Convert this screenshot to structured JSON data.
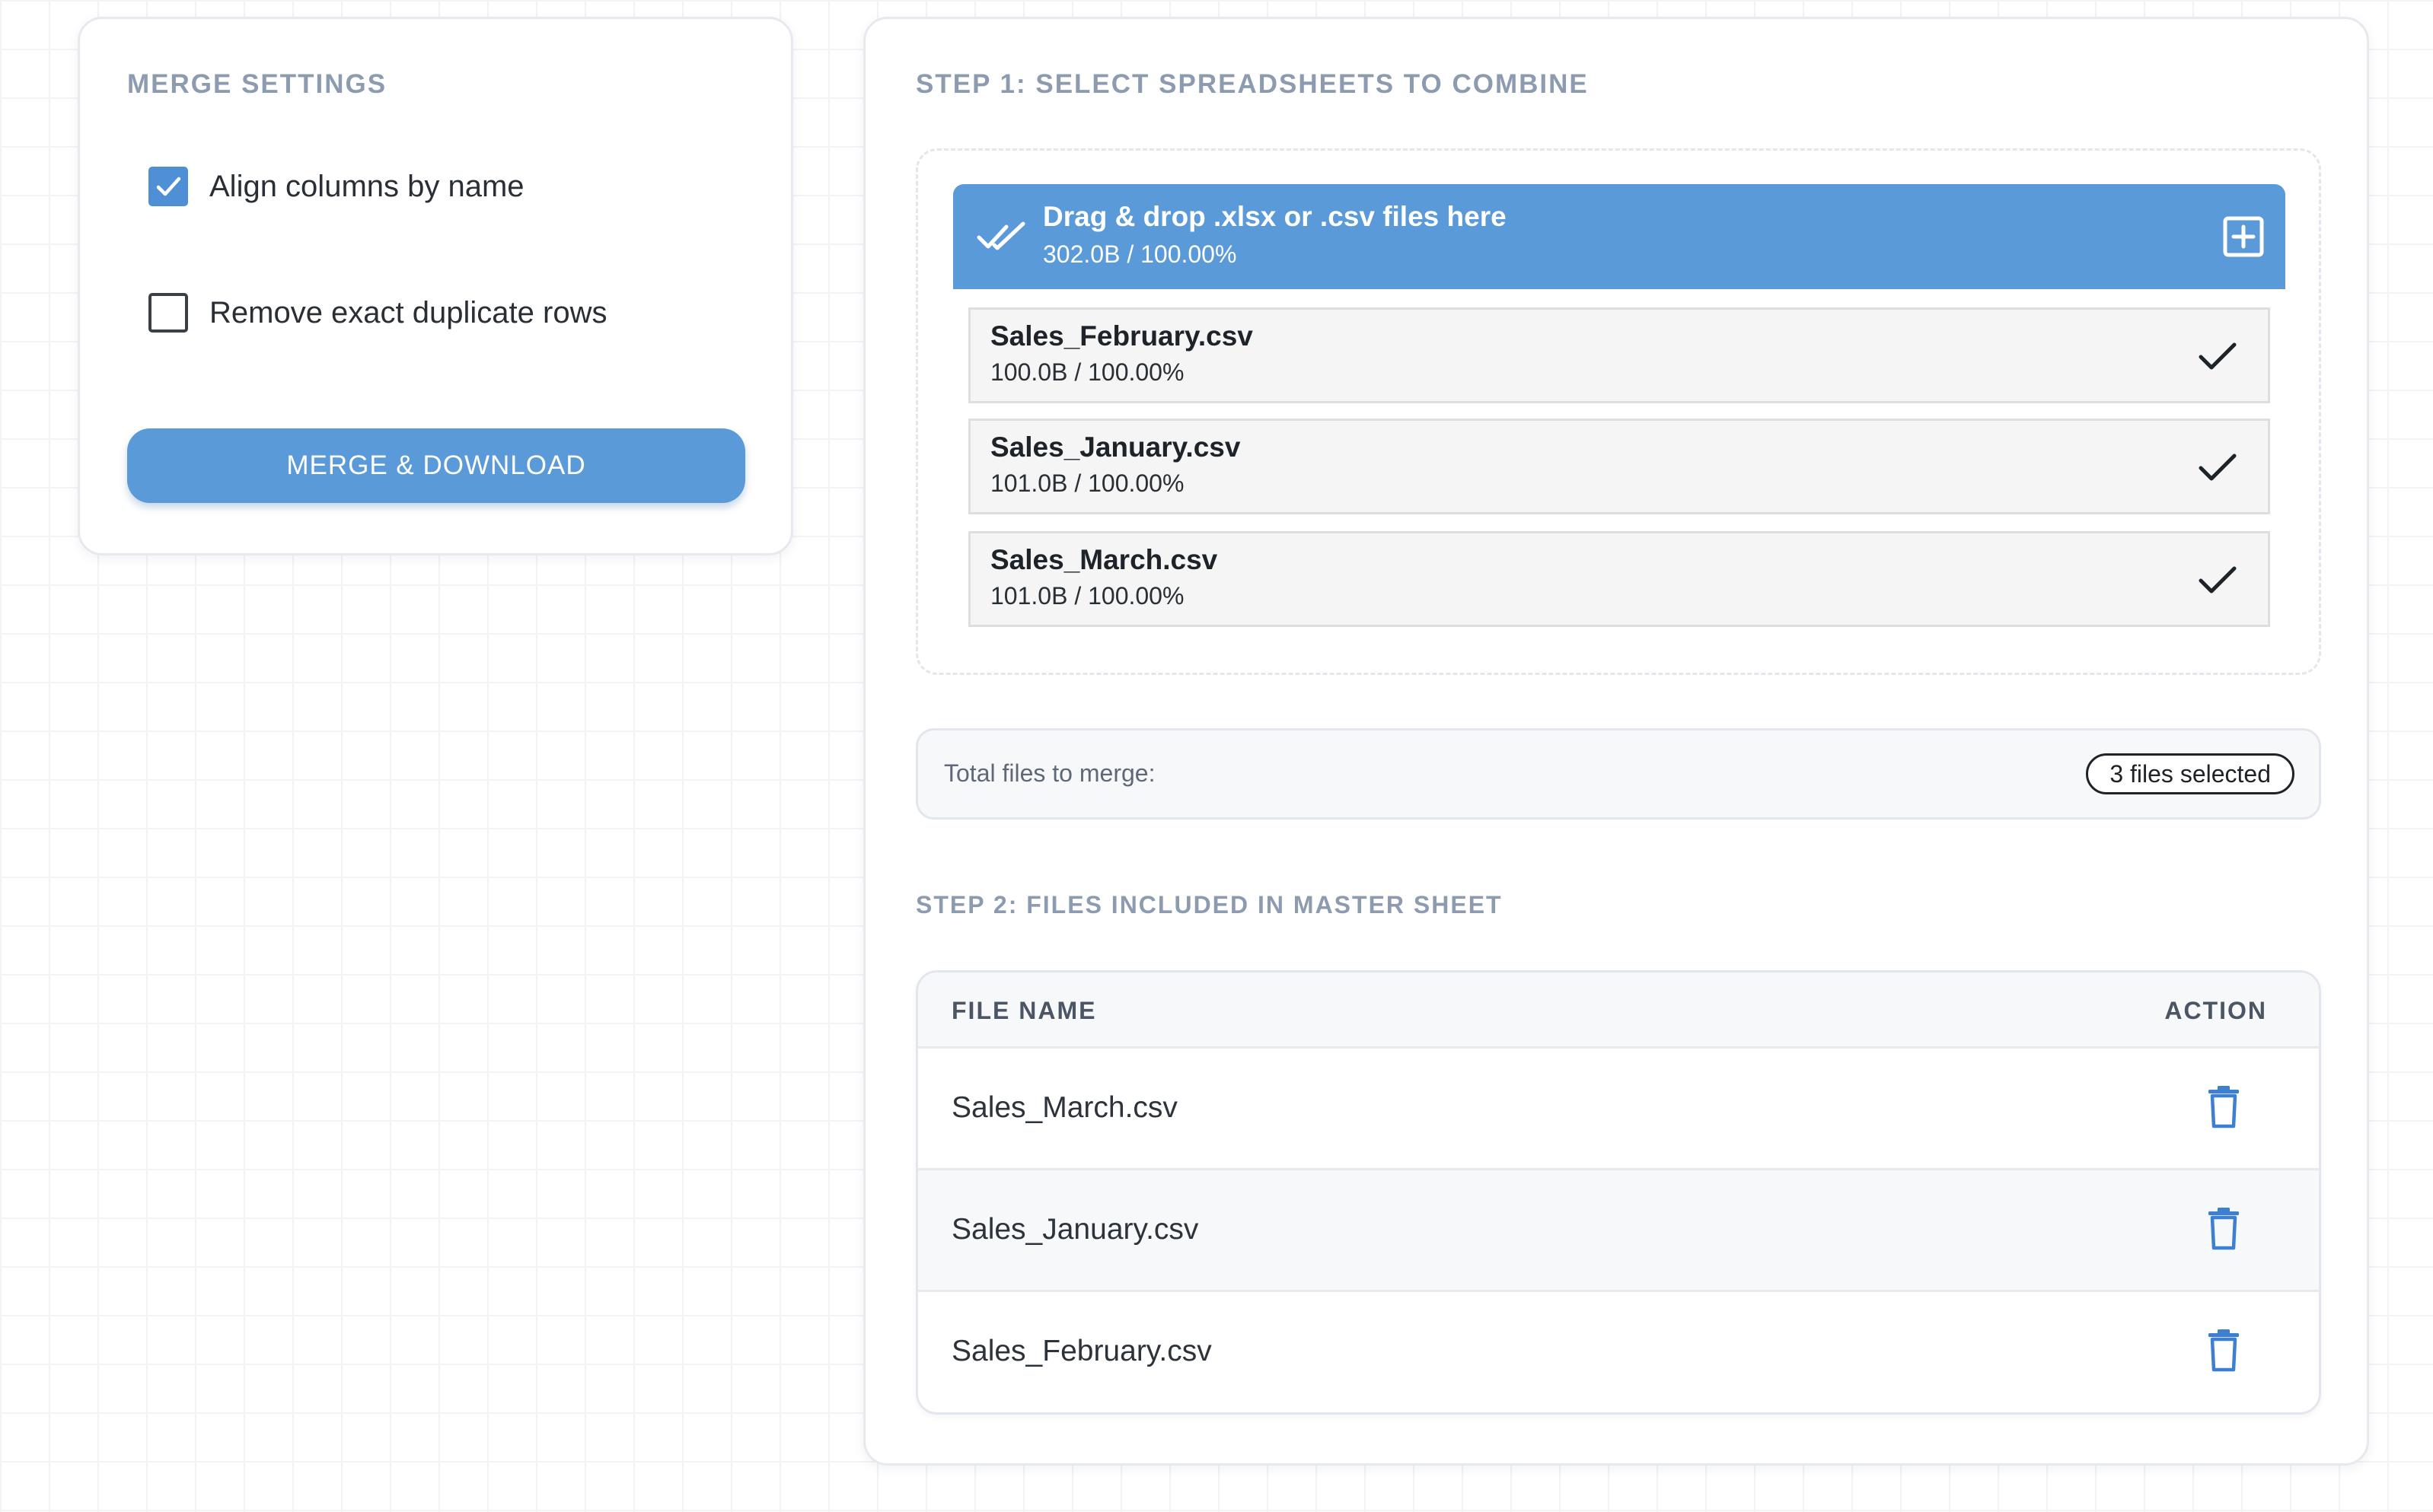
{
  "settings": {
    "title": "MERGE SETTINGS",
    "options": [
      {
        "label": "Align columns by name",
        "checked": true
      },
      {
        "label": "Remove exact duplicate rows",
        "checked": false
      }
    ],
    "merge_button_label": "MERGE & DOWNLOAD"
  },
  "step1": {
    "title": "STEP 1: SELECT SPREADSHEETS TO COMBINE",
    "dropzone": {
      "title": "Drag & drop .xlsx or .csv files here",
      "progress": "302.0B / 100.00%"
    },
    "files": [
      {
        "name": "Sales_February.csv",
        "progress": "100.0B / 100.00%"
      },
      {
        "name": "Sales_January.csv",
        "progress": "101.0B / 100.00%"
      },
      {
        "name": "Sales_March.csv",
        "progress": "101.0B / 100.00%"
      }
    ],
    "total_label": "Total files to merge:",
    "total_badge": "3 files selected"
  },
  "step2": {
    "title": "STEP 2: FILES INCLUDED IN MASTER SHEET",
    "columns": {
      "name": "FILE NAME",
      "action": "ACTION"
    },
    "rows": [
      {
        "name": "Sales_March.csv",
        "action_icon": "trash-icon"
      },
      {
        "name": "Sales_January.csv",
        "action_icon": "trash-icon"
      },
      {
        "name": "Sales_February.csv",
        "action_icon": "trash-icon"
      }
    ]
  },
  "colors": {
    "accent": "#5b9ad9",
    "checkbox_checked": "#4f8fd6",
    "section_title": "#8d9bb0",
    "trash_icon": "#3d7fd0"
  }
}
